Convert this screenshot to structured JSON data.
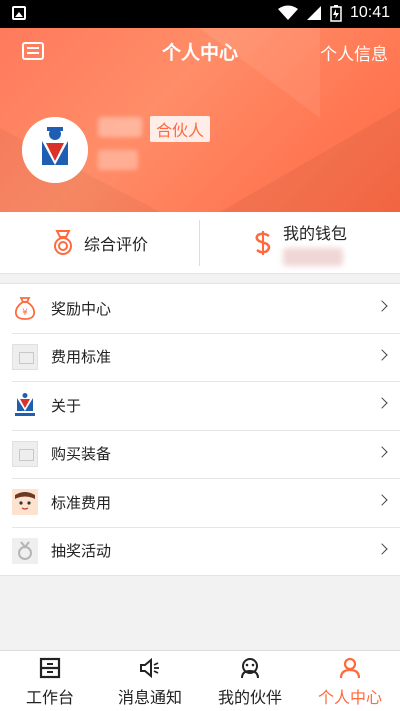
{
  "status_bar": {
    "time": "10:41"
  },
  "header": {
    "title": "个人中心",
    "right_link": "个人信息",
    "badge": "合伙人"
  },
  "stats": {
    "rating_label": "综合评价",
    "wallet_label": "我的钱包"
  },
  "menu": [
    {
      "label": "奖励中心",
      "icon": "money-bag-icon"
    },
    {
      "label": "费用标准",
      "icon": "image-placeholder-icon"
    },
    {
      "label": "关于",
      "icon": "logo-icon"
    },
    {
      "label": "购买装备",
      "icon": "image-placeholder-icon"
    },
    {
      "label": "标准费用",
      "icon": "cartoon-avatar-icon"
    },
    {
      "label": "抽奖活动",
      "icon": "lottery-icon"
    }
  ],
  "tabs": [
    {
      "label": "工作台",
      "icon": "workbench-icon"
    },
    {
      "label": "消息通知",
      "icon": "speaker-icon"
    },
    {
      "label": "我的伙伴",
      "icon": "partner-icon"
    },
    {
      "label": "个人中心",
      "icon": "person-icon"
    }
  ],
  "colors": {
    "accent": "#ff6a3d",
    "header": "#ff7a5c"
  }
}
